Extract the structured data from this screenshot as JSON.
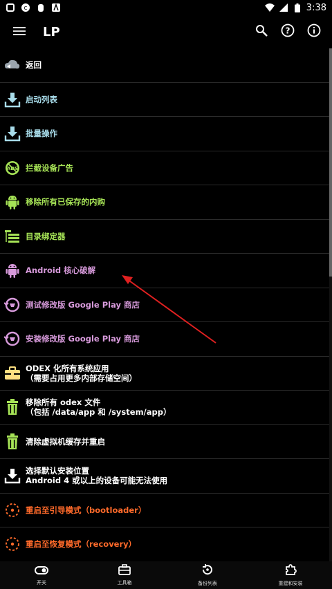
{
  "status": {
    "time": "3:38"
  },
  "appbar": {
    "title": "LP",
    "icons": [
      "menu-icon",
      "search-icon",
      "help-icon",
      "info-icon"
    ]
  },
  "items": [
    {
      "label": "返回",
      "icon": "back-cloud-icon",
      "color": "#ffffff"
    },
    {
      "label": "启动列表",
      "icon": "download-icon",
      "color": "#a8dcea"
    },
    {
      "label": "批量操作",
      "icon": "download-icon",
      "color": "#a8dcea"
    },
    {
      "label": "拦截设备广告",
      "icon": "ads-block-icon",
      "color": "#a6e356"
    },
    {
      "label": "移除所有已保存的内购",
      "icon": "android-icon",
      "color": "#a6e356"
    },
    {
      "label": "目录绑定器",
      "icon": "folder-tree-icon",
      "color": "#a6e356"
    },
    {
      "label": "Android 核心破解",
      "icon": "android-icon",
      "color": "#d79adb"
    },
    {
      "label": "测试修改版 Google Play 商店",
      "icon": "play-store-icon",
      "color": "#d79adb"
    },
    {
      "label": "安装修改版 Google Play 商店",
      "icon": "play-store-icon",
      "color": "#d79adb"
    },
    {
      "label": "ODEX 化所有系统应用\n（需要占用更多内部存储空间）",
      "icon": "toolbox-icon",
      "color": "#ffffff"
    },
    {
      "label": "移除所有 odex 文件\n（包括 /data/app 和 /system/app）",
      "icon": "trash-icon",
      "color": "#ffffff"
    },
    {
      "label": "清除虚拟机缓存并重启",
      "icon": "trash-icon",
      "color": "#ffffff"
    },
    {
      "label": "选择默认安装位置\nAndroid 4 或以上的设备可能无法使用",
      "icon": "download-icon",
      "color": "#ffffff"
    },
    {
      "label": "重启至引导模式（bootloader）",
      "icon": "reboot-icon",
      "color": "#ff6a2a"
    },
    {
      "label": "重启至恢复模式（recovery）",
      "icon": "reboot-icon",
      "color": "#ff6a2a"
    }
  ],
  "bottom_nav": [
    {
      "label": "开关",
      "icon": "toggle-icon"
    },
    {
      "label": "工具箱",
      "icon": "toolbox-icon"
    },
    {
      "label": "备份列表",
      "icon": "backup-icon"
    },
    {
      "label": "重建和安装",
      "icon": "puzzle-icon"
    }
  ]
}
